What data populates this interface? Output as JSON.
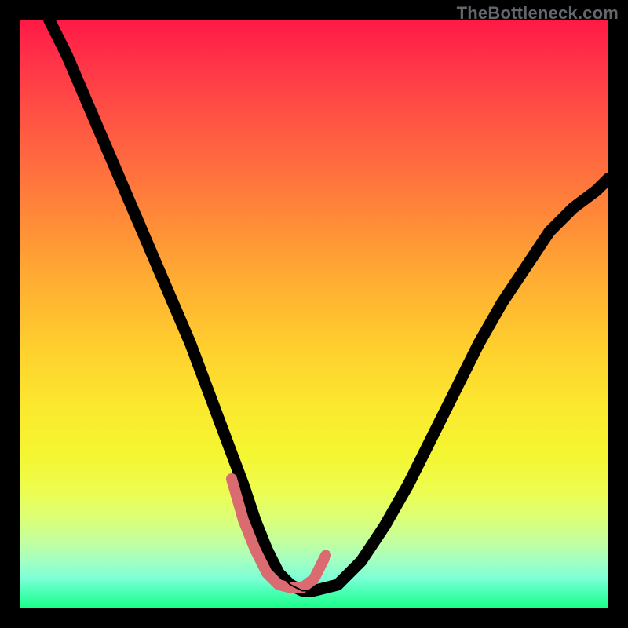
{
  "watermark": "TheBottleneck.com",
  "chart_data": {
    "type": "line",
    "title": "",
    "xlabel": "",
    "ylabel": "",
    "xlim": [
      0,
      100
    ],
    "ylim": [
      0,
      100
    ],
    "axes_visible": false,
    "grid": false,
    "legend": false,
    "background": {
      "type": "vertical_gradient",
      "stops": [
        {
          "pos": 0.0,
          "color": "#ff1946"
        },
        {
          "pos": 0.5,
          "color": "#ffc030"
        },
        {
          "pos": 0.75,
          "color": "#f4f631"
        },
        {
          "pos": 1.0,
          "color": "#18ff87"
        }
      ],
      "description": "red at top through orange/yellow to green at bottom; y maps to bottleneck (green=low, red=high)"
    },
    "series": [
      {
        "name": "bottleneck-curve",
        "color": "#000000",
        "x": [
          5,
          8,
          11,
          14,
          17,
          20,
          23,
          26,
          29,
          32,
          35,
          38,
          40,
          42,
          44,
          46,
          48,
          50,
          54,
          58,
          62,
          66,
          70,
          74,
          78,
          82,
          86,
          90,
          94,
          98,
          100
        ],
        "y": [
          100,
          94,
          87,
          80,
          73,
          66,
          59,
          52,
          45,
          37,
          29,
          21,
          15,
          10,
          6,
          4,
          3,
          3,
          4,
          8,
          14,
          21,
          29,
          37,
          45,
          52,
          58,
          64,
          68,
          71,
          73
        ]
      },
      {
        "name": "optimal-region",
        "color": "#da6b70",
        "stroke_width_hint": 14,
        "description": "thick salmon-colored overlay marking the low-bottleneck range at the bottom of the V",
        "x": [
          36,
          38,
          40,
          42,
          44,
          46,
          48,
          50,
          52
        ],
        "y": [
          22,
          15,
          10,
          6,
          4,
          3.5,
          3.5,
          5,
          9
        ]
      }
    ]
  }
}
